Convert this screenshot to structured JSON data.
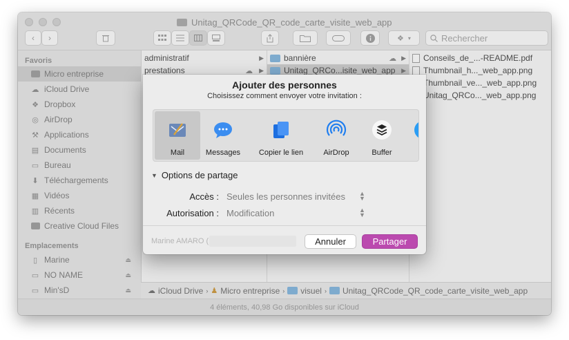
{
  "window": {
    "title": "Unitag_QRCode_QR_code_carte_visite_web_app",
    "search_placeholder": "Rechercher",
    "status": "4 éléments, 40,98 Go disponibles sur iCloud"
  },
  "sidebar": {
    "favorites_header": "Favoris",
    "favorites": [
      {
        "label": "Micro entreprise",
        "icon": "folder-icon"
      },
      {
        "label": "iCloud Drive",
        "icon": "cloud-icon"
      },
      {
        "label": "Dropbox",
        "icon": "dropbox-icon"
      },
      {
        "label": "AirDrop",
        "icon": "airdrop-icon"
      },
      {
        "label": "Applications",
        "icon": "applications-icon"
      },
      {
        "label": "Documents",
        "icon": "documents-icon"
      },
      {
        "label": "Bureau",
        "icon": "desktop-icon"
      },
      {
        "label": "Téléchargements",
        "icon": "downloads-icon"
      },
      {
        "label": "Vidéos",
        "icon": "movies-icon"
      },
      {
        "label": "Récents",
        "icon": "recents-icon"
      },
      {
        "label": "Creative Cloud Files",
        "icon": "folder-icon"
      }
    ],
    "locations_header": "Emplacements",
    "locations": [
      {
        "label": "Marine",
        "icon": "computer-icon"
      },
      {
        "label": "NO NAME",
        "icon": "drive-icon"
      },
      {
        "label": "Min'sD",
        "icon": "drive-icon"
      }
    ]
  },
  "columns": {
    "col1": [
      "administratif",
      "prestations"
    ],
    "col2": [
      "bannière",
      "Unitag_QRCo...isite_web_app"
    ],
    "col3": [
      "Conseils_de_...-README.pdf",
      "Thumbnail_h..._web_app.png",
      "Thumbnail_ve..._web_app.png",
      "Unitag_QRCo..._web_app.png"
    ]
  },
  "pathbar": [
    "iCloud Drive",
    "Micro entreprise",
    "visuel",
    "Unitag_QRCode_QR_code_carte_visite_web_app"
  ],
  "sheet": {
    "title": "Ajouter des personnes",
    "subtitle": "Choisissez comment envoyer votre invitation :",
    "services": [
      {
        "label": "Mail",
        "icon": "mail-icon"
      },
      {
        "label": "Messages",
        "icon": "messages-icon"
      },
      {
        "label": "Copier le lien",
        "icon": "copy-link-icon"
      },
      {
        "label": "AirDrop",
        "icon": "airdrop-icon"
      },
      {
        "label": "Buffer",
        "icon": "buffer-icon"
      },
      {
        "label": "Tw",
        "icon": "twitter-icon"
      }
    ],
    "options_header": "Options de partage",
    "access_label": "Accès :",
    "access_value": "Seules les personnes invitées",
    "permission_label": "Autorisation :",
    "permission_value": "Modification",
    "owner": "Marine AMARO (",
    "cancel": "Annuler",
    "share": "Partager"
  },
  "colors": {
    "accent": "#bb4aaf",
    "folder": "#7fb2da",
    "selection": "#cccccc"
  }
}
